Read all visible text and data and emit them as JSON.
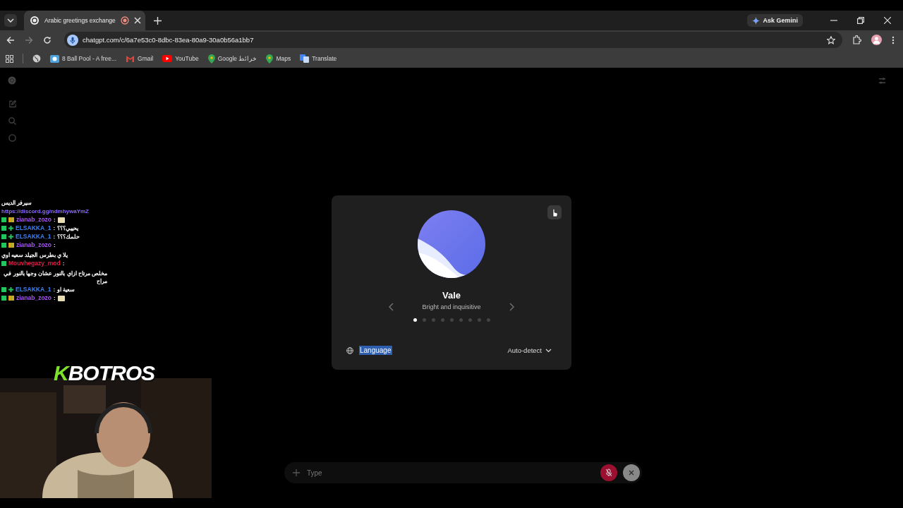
{
  "browser": {
    "tab": {
      "title": "Arabic greetings exchange",
      "recording": true
    },
    "address": "chatgpt.com/c/6a7e53c0-8dbc-83ea-80a9-30a0b56a1bb7",
    "gemini_button": "Ask Gemini",
    "bookmarks": [
      {
        "label": "8 Ball Pool - A free...",
        "kind": "game"
      },
      {
        "label": "Gmail",
        "kind": "mail"
      },
      {
        "label": "YouTube",
        "kind": "video"
      },
      {
        "label": "Google خرائط",
        "kind": "map"
      },
      {
        "label": "Maps",
        "kind": "map"
      },
      {
        "label": "Translate",
        "kind": "translate"
      }
    ]
  },
  "voice_dialog": {
    "name": "Vale",
    "description": "Bright and inquisitive",
    "dots": [
      {
        "selected": true
      },
      {
        "selected": false
      },
      {
        "selected": false
      },
      {
        "selected": false
      },
      {
        "selected": false
      },
      {
        "selected": false
      },
      {
        "selected": false
      },
      {
        "selected": false
      },
      {
        "selected": false
      }
    ],
    "language_label": "Language",
    "language_label_highlighted": true,
    "language_value": "Auto-detect"
  },
  "composer": {
    "placeholder": "Type",
    "mic_muted": true
  },
  "stream_chat": [
    {
      "text": "سيرفر الديس",
      "link": false
    },
    {
      "text": "https://discord.gg/ndmhywaYmZ",
      "link": true
    },
    {
      "user": "zianab_zozo",
      "color": "#a855f7",
      "kind": "gift",
      "separator": ":",
      "emote": true
    },
    {
      "user": "ELSAKKA_1",
      "color": "#3b82f6",
      "kind": "plus",
      "separator": ":",
      "text": "يحييي؟؟؟"
    },
    {
      "user": "ELSAKKA_1",
      "color": "#3b82f6",
      "kind": "plus",
      "separator": ":",
      "text": "حلمك؟؟؟"
    },
    {
      "user": "zianab_zozo",
      "color": "#a855f7",
      "kind": "gift",
      "separator": ":",
      "text": "يلا ي بطرس الجيلد سعيه اوي"
    },
    {
      "user": "Mouvhegazy_mod",
      "color": "#e11d48",
      "kind": "mod",
      "separator": ":",
      "text": "مخلص مرتاح ازاي بالنور عشان وجها بالنور في مراح"
    },
    {
      "user": "ELSAKKA_1",
      "color": "#3b82f6",
      "kind": "plus",
      "separator": ":",
      "text": "سعية او"
    },
    {
      "user": "zianab_zozo",
      "color": "#a855f7",
      "kind": "gift",
      "separator": ":",
      "emote": true
    }
  ],
  "streamer_logo": {
    "initial": "K",
    "name": "BOTROS"
  }
}
